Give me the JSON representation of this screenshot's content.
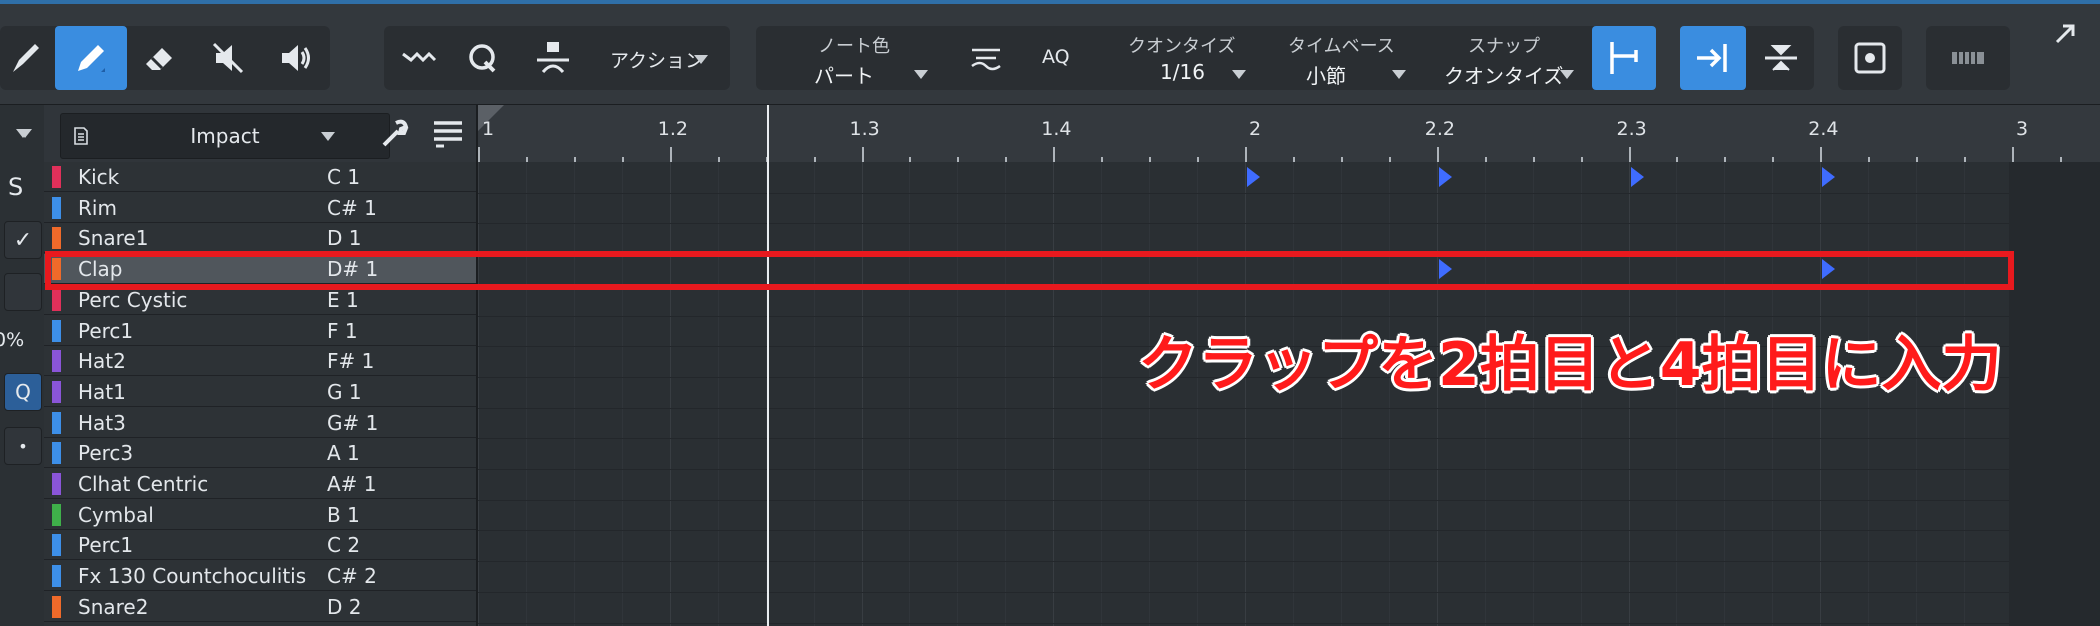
{
  "toolbar": {
    "action_label": "アクション",
    "note_color_label": "ノート色",
    "note_color_value": "パート",
    "aq_label": "AQ",
    "quantize_label": "クオンタイズ",
    "quantize_value": "1/16",
    "timebase_label": "タイムベース",
    "timebase_value": "小節",
    "snap_label": "スナップ",
    "snap_value": "クオンタイズ",
    "tools": [
      "arrow-tool-icon",
      "pencil-icon",
      "eraser-icon",
      "mute-icon",
      "speaker-icon"
    ],
    "accent": "#3a8de0"
  },
  "left_controls": {
    "solo_label": "S",
    "percent_label": "0%",
    "q_label": "Q"
  },
  "instrument": {
    "name": "Impact"
  },
  "ruler": {
    "labels": [
      "1",
      "1.2",
      "1.3",
      "1.4",
      "2",
      "2.2",
      "2.3",
      "2.4",
      "3"
    ]
  },
  "drums": [
    {
      "name": "Kick",
      "note": "C 1",
      "color": "#e0305a"
    },
    {
      "name": "Rim",
      "note": "C# 1",
      "color": "#3d8fe8"
    },
    {
      "name": "Snare1",
      "note": "D 1",
      "color": "#ef6a2a"
    },
    {
      "name": "Clap",
      "note": "D# 1",
      "color": "#ef6a2a",
      "selected": true
    },
    {
      "name": "Perc Cystic",
      "note": "E 1",
      "color": "#e0305a"
    },
    {
      "name": "Perc1",
      "note": "F 1",
      "color": "#3d8fe8"
    },
    {
      "name": "Hat2",
      "note": "F# 1",
      "color": "#8a55d8"
    },
    {
      "name": "Hat1",
      "note": "G 1",
      "color": "#8a55d8"
    },
    {
      "name": "Hat3",
      "note": "G# 1",
      "color": "#3d8fe8"
    },
    {
      "name": "Perc3",
      "note": "A 1",
      "color": "#3d8fe8"
    },
    {
      "name": "Clhat Centric",
      "note": "A# 1",
      "color": "#8a55d8"
    },
    {
      "name": "Cymbal",
      "note": "B 1",
      "color": "#3fb04a"
    },
    {
      "name": "Perc1",
      "note": "C 2",
      "color": "#3d8fe8"
    },
    {
      "name": "Fx 130 Countchoculitis",
      "note": "C# 2",
      "color": "#3d8fe8"
    },
    {
      "name": "Snare2",
      "note": "D 2",
      "color": "#ef6a2a"
    }
  ],
  "notes": [
    {
      "row": 0,
      "position": "2"
    },
    {
      "row": 0,
      "position": "2.2"
    },
    {
      "row": 0,
      "position": "2.3"
    },
    {
      "row": 0,
      "position": "2.4"
    },
    {
      "row": 3,
      "position": "2.2"
    },
    {
      "row": 3,
      "position": "2.4"
    }
  ],
  "annotation": {
    "caption": "クラップを2拍目と4拍目に入力",
    "color": "#e8191e"
  }
}
